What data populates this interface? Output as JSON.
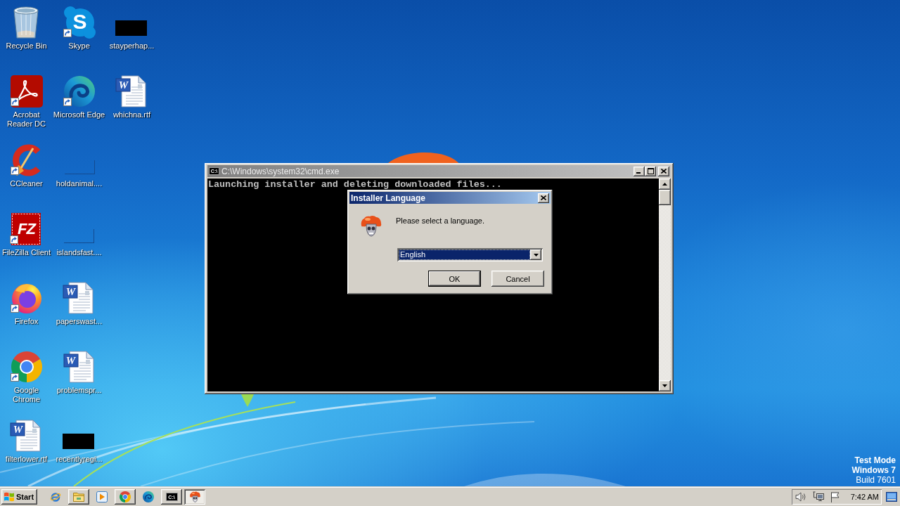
{
  "desktop": {
    "icon_columns": [
      [
        {
          "label": "Recycle Bin",
          "kind": "recycle-bin",
          "shortcut": false
        },
        {
          "label": "Acrobat Reader DC",
          "kind": "acrobat",
          "shortcut": true
        },
        {
          "label": "CCleaner",
          "kind": "ccleaner",
          "shortcut": true
        },
        {
          "label": "FileZilla Client",
          "kind": "filezilla",
          "glyph": "FZ",
          "shortcut": true
        },
        {
          "label": "Firefox",
          "kind": "firefox",
          "shortcut": true
        },
        {
          "label": "Google Chrome",
          "kind": "chrome",
          "shortcut": true
        },
        {
          "label": "filterlower.rtf",
          "kind": "word-document",
          "glyph": "W",
          "shortcut": false
        }
      ],
      [
        {
          "label": "Skype",
          "kind": "skype",
          "glyph": "S",
          "shortcut": true
        },
        {
          "label": "Microsoft Edge",
          "kind": "edge",
          "shortcut": true
        },
        {
          "label": "holdanimal....",
          "kind": "file-outline",
          "shortcut": false
        },
        {
          "label": "islandsfast....",
          "kind": "file-outline",
          "shortcut": false
        },
        {
          "label": "paperswast...",
          "kind": "word-document",
          "glyph": "W",
          "shortcut": false
        },
        {
          "label": "problemspr...",
          "kind": "word-document",
          "glyph": "W",
          "shortcut": false
        },
        {
          "label": "recentlyregi...",
          "kind": "thumbnail",
          "shortcut": false
        }
      ],
      [
        {
          "label": "stayperhap...",
          "kind": "thumbnail",
          "shortcut": false
        },
        {
          "label": "whichna.rtf",
          "kind": "word-document",
          "glyph": "W",
          "shortcut": false
        }
      ]
    ],
    "notice": [
      {
        "text": "Test Mode",
        "bold": true
      },
      {
        "text": "Windows 7",
        "bold": true
      },
      {
        "text": "Build 7601",
        "bold": false
      }
    ]
  },
  "console_window": {
    "icon_glyph": "C:\\",
    "title": "C:\\Windows\\system32\\cmd.exe",
    "active": false,
    "lines": [
      "Launching installer and deleting downloaded files..."
    ]
  },
  "dialog": {
    "title": "Installer Language",
    "active": true,
    "message": "Please select a language.",
    "language_select": {
      "value": "English",
      "focused": true
    },
    "buttons": [
      {
        "label": "OK",
        "default": true
      },
      {
        "label": "Cancel",
        "default": false
      }
    ]
  },
  "taskbar": {
    "start_label": "Start",
    "items": [
      {
        "kind": "ie",
        "running": false,
        "selected": false
      },
      {
        "kind": "folder",
        "running": true,
        "selected": false
      },
      {
        "kind": "media",
        "running": false,
        "selected": false
      },
      {
        "kind": "chrome",
        "running": true,
        "selected": false
      },
      {
        "kind": "edge",
        "running": false,
        "selected": false
      },
      {
        "kind": "console",
        "glyph": "C:\\",
        "running": true,
        "selected": false
      },
      {
        "kind": "skull",
        "running": true,
        "selected": true
      }
    ],
    "clock": "7:42 AM"
  }
}
